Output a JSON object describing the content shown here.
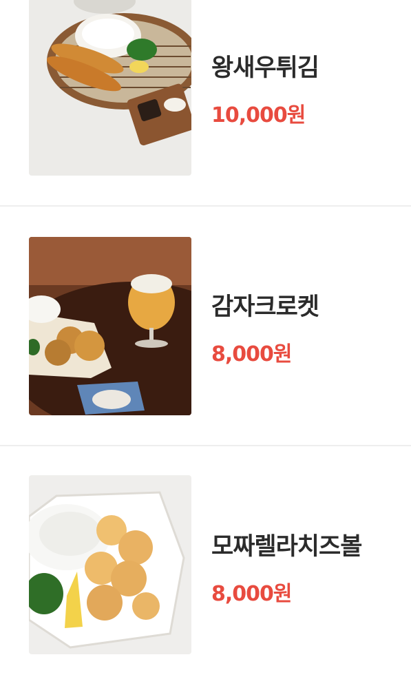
{
  "menu": {
    "items": [
      {
        "name": "왕새우튀김",
        "price": "10,000원",
        "image": "fried-jumbo-shrimp-photo"
      },
      {
        "name": "감자크로켓",
        "price": "8,000원",
        "image": "potato-croquette-photo"
      },
      {
        "name": "모짜렐라치즈볼",
        "price": "8,000원",
        "image": "mozzarella-cheese-ball-photo"
      }
    ]
  },
  "colors": {
    "price": "#e84b3f",
    "name": "#2b2b2b",
    "divider": "#eeeeee"
  }
}
